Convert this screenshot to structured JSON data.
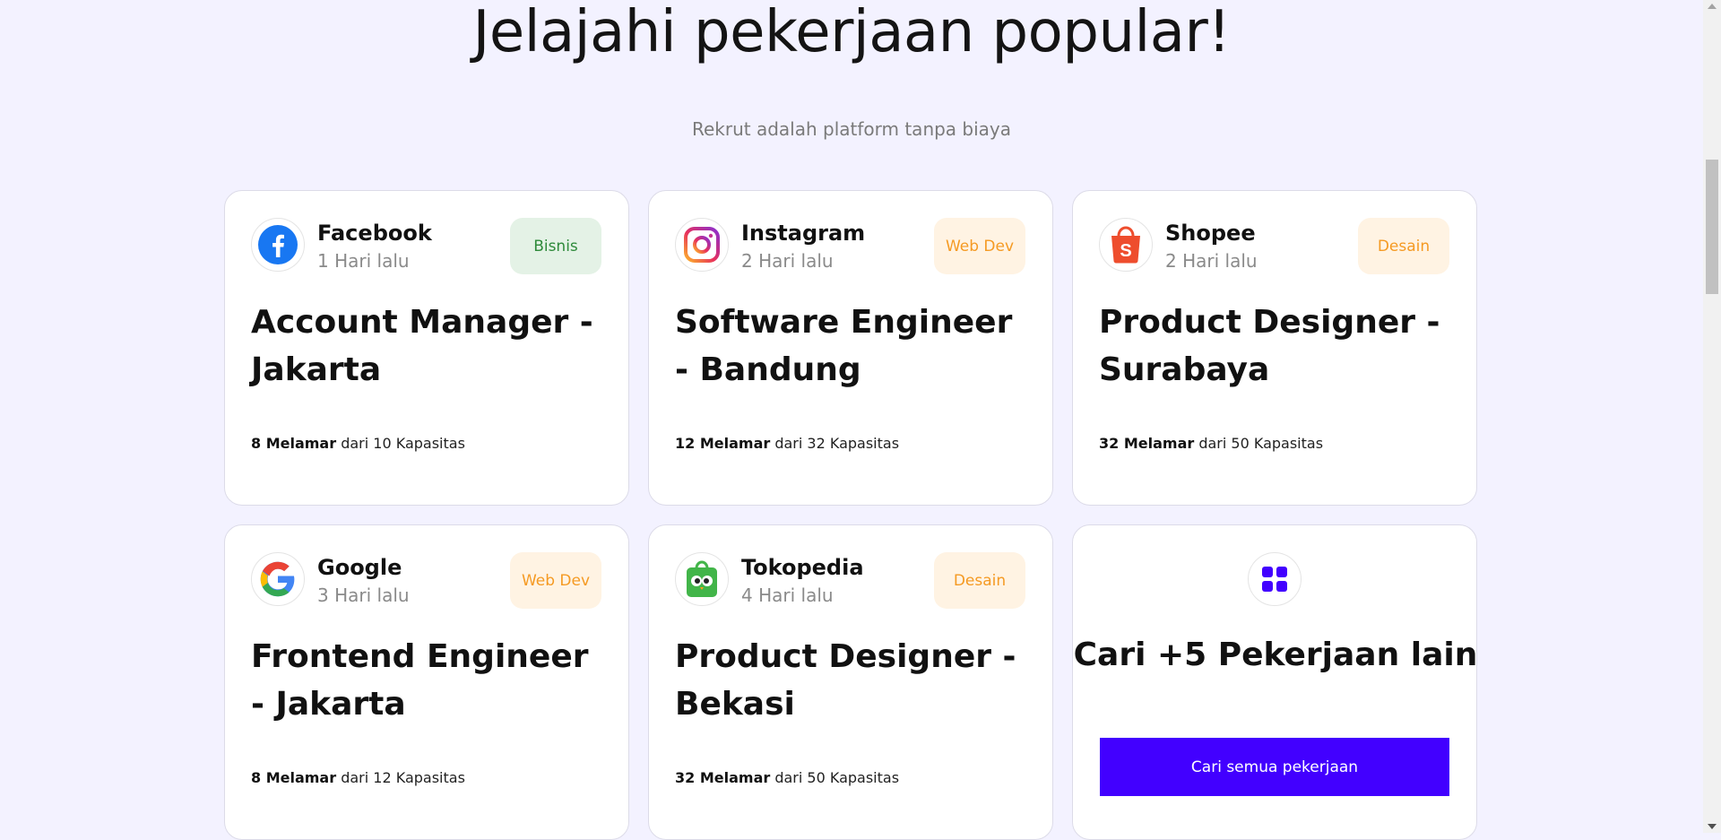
{
  "header": {
    "title": "Jelajahi pekerjaan popular!",
    "subtitle": "Rekrut adalah platform tanpa biaya"
  },
  "jobs": [
    {
      "company": "Facebook",
      "posted": "1 Hari lalu",
      "tag": "Bisnis",
      "title": "Account Manager - Jakarta",
      "applicants": "8 Melamar",
      "capacity": "dari 10 Kapasitas",
      "logo_icon": "facebook-logo-icon"
    },
    {
      "company": "Instagram",
      "posted": "2 Hari lalu",
      "tag": "Web Dev",
      "title": "Software Engineer - Bandung",
      "applicants": "12 Melamar",
      "capacity": "dari 32 Kapasitas",
      "logo_icon": "instagram-logo-icon"
    },
    {
      "company": "Shopee",
      "posted": "2 Hari lalu",
      "tag": "Desain",
      "title": "Product Designer - Surabaya",
      "applicants": "32 Melamar",
      "capacity": "dari 50 Kapasitas",
      "logo_icon": "shopee-logo-icon"
    },
    {
      "company": "Google",
      "posted": "3 Hari lalu",
      "tag": "Web Dev",
      "title": "Frontend Engineer - Jakarta",
      "applicants": "8 Melamar",
      "capacity": "dari 12 Kapasitas",
      "logo_icon": "google-logo-icon"
    },
    {
      "company": "Tokopedia",
      "posted": "4 Hari lalu",
      "tag": "Desain",
      "title": "Product Designer - Bekasi",
      "applicants": "32 Melamar",
      "capacity": "dari 50 Kapasitas",
      "logo_icon": "tokopedia-logo-icon"
    }
  ],
  "more": {
    "title": "Cari +5 Pekerjaan lain",
    "button_label": "Cari semua pekerjaan",
    "icon": "grid-icon"
  },
  "tag_styles": {
    "Bisnis": {
      "bg": "#e4f2e6",
      "fg": "#2e8a3a"
    },
    "Web Dev": {
      "bg": "#fff3e3",
      "fg": "#f59a23"
    },
    "Desain": {
      "bg": "#fff3e3",
      "fg": "#f59a23"
    }
  },
  "colors": {
    "page_bg": "#f3f2ff",
    "accent": "#4200ff"
  }
}
